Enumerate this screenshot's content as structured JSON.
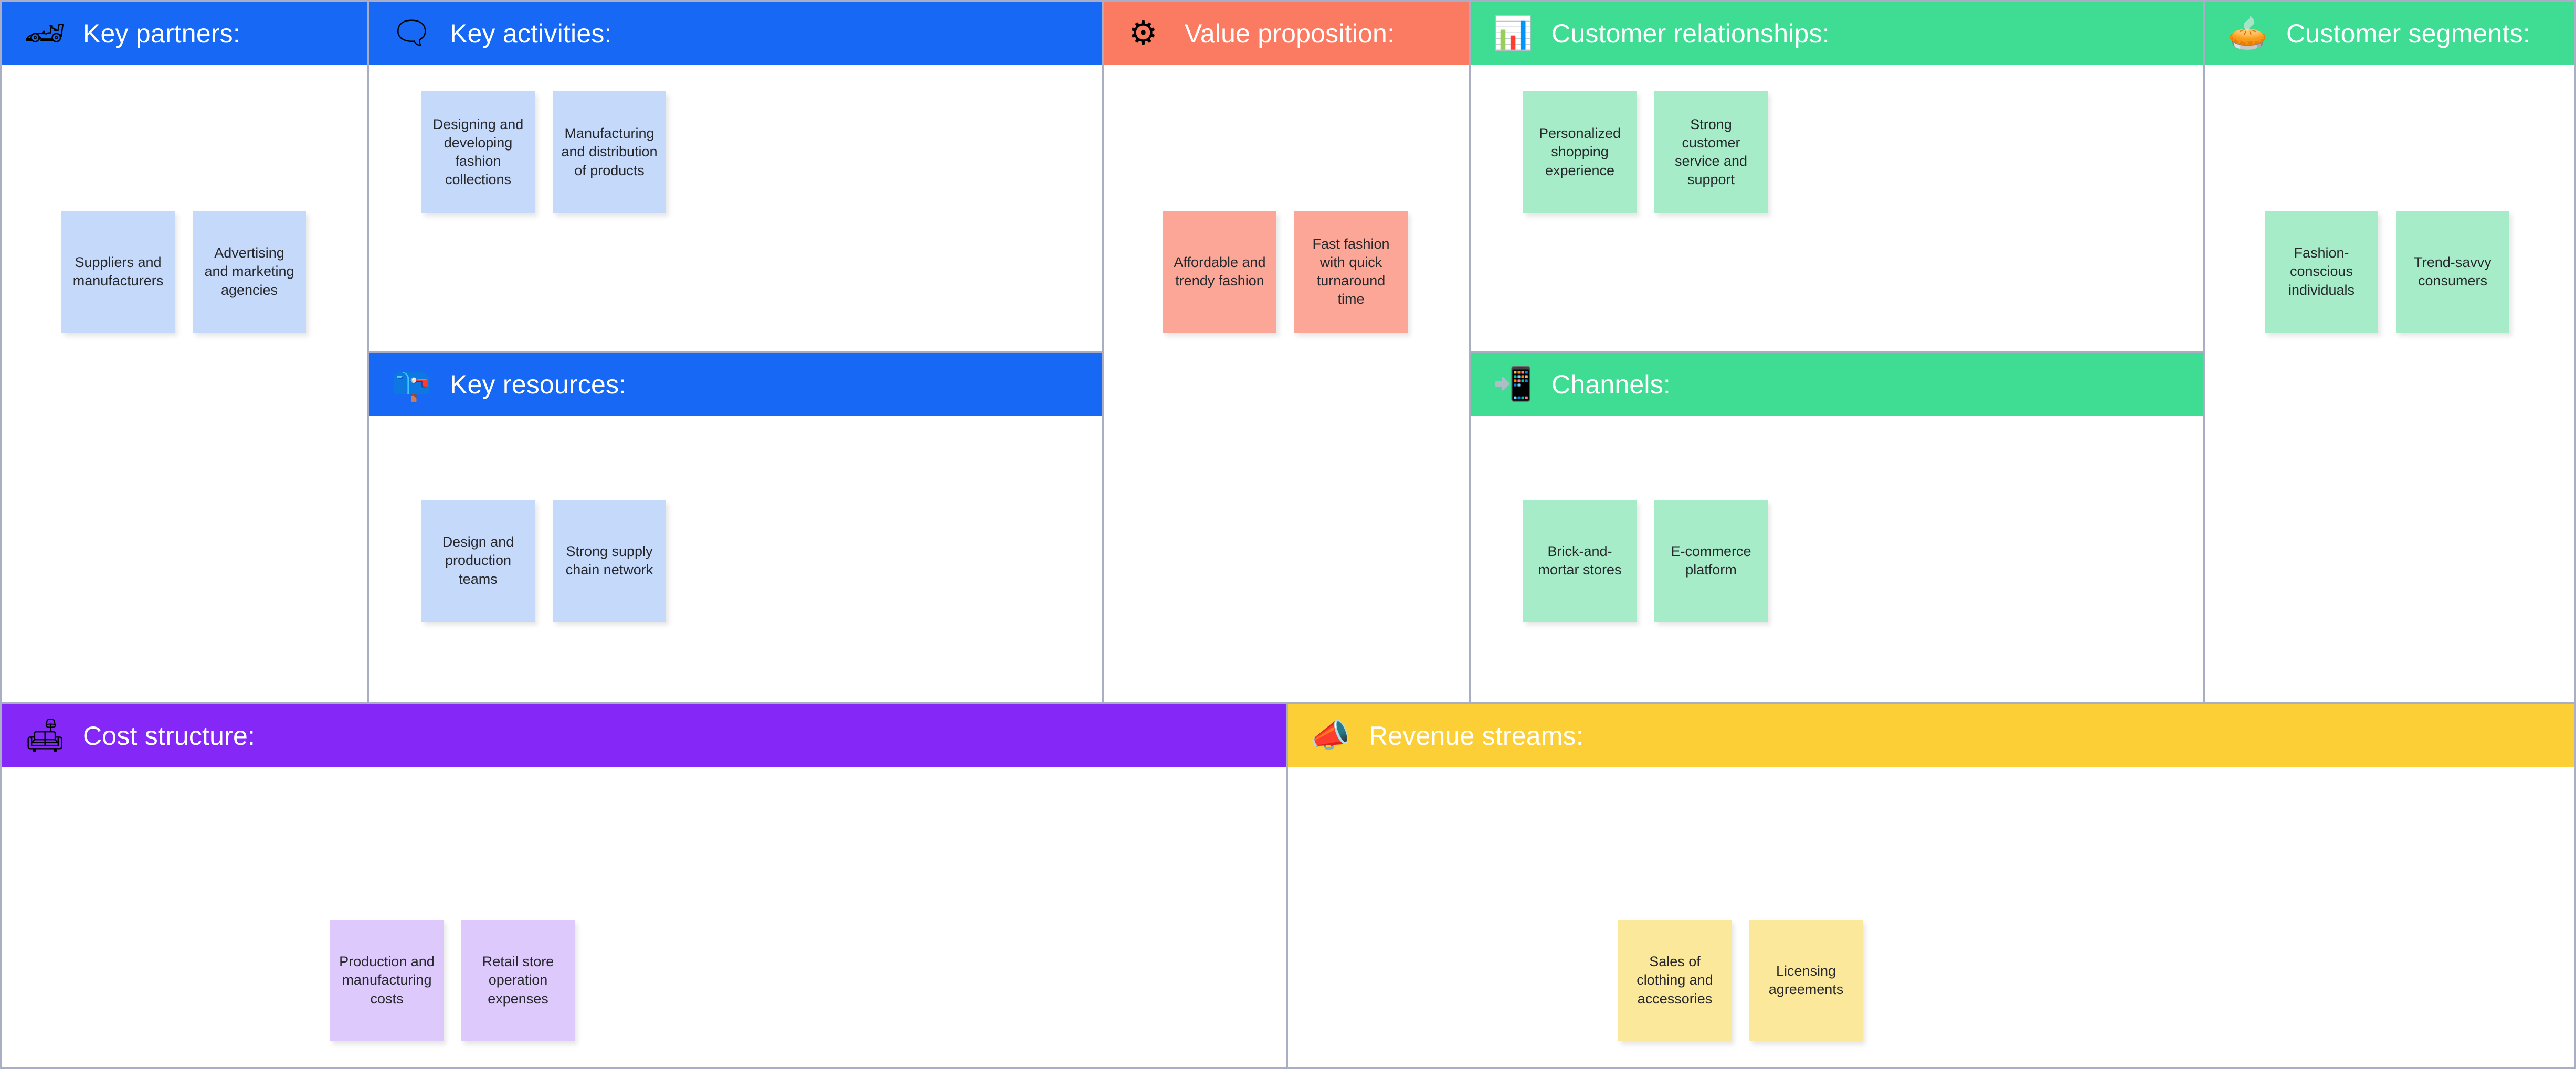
{
  "theme": {
    "background": "#a9aec4",
    "panel": "#ffffff",
    "blue": "#1668f5",
    "salmon": "#fb7b62",
    "green": "#3fdc93",
    "purple": "#8427f7",
    "yellow": "#fbcf35",
    "note_blue": "#c5d9fb",
    "note_salmon": "#fba696",
    "note_green": "#a6ecc8",
    "note_purple": "#ddc9fb",
    "note_yellow": "#fbe89a"
  },
  "blocks": {
    "key_partners": {
      "title": "Key partners:",
      "icon": "racing-car-icon",
      "icon_glyph": "🏎",
      "notes": [
        {
          "text": "Suppliers and manufacturers"
        },
        {
          "text": "Advertising and marketing agencies"
        }
      ]
    },
    "key_activities": {
      "title": "Key activities:",
      "icon": "speech-balloon-icon",
      "icon_glyph": "🗨",
      "notes": [
        {
          "text": "Designing and developing fashion collections"
        },
        {
          "text": "Manufacturing and distribution of products"
        }
      ]
    },
    "key_resources": {
      "title": "Key resources:",
      "icon": "mailbox-icon",
      "icon_glyph": "📪",
      "notes": [
        {
          "text": "Design and production teams"
        },
        {
          "text": "Strong supply chain network"
        }
      ]
    },
    "value_proposition": {
      "title": "Value proposition:",
      "icon": "gears-icon",
      "icon_glyph": "⚙",
      "notes": [
        {
          "text": "Affordable and trendy fashion"
        },
        {
          "text": "Fast fashion with quick turnaround time"
        }
      ]
    },
    "customer_relationships": {
      "title": "Customer relationships:",
      "icon": "bar-chart-icon",
      "icon_glyph": "📊",
      "notes": [
        {
          "text": "Personalized shopping experience"
        },
        {
          "text": "Strong customer service and support"
        }
      ]
    },
    "channels": {
      "title": "Channels:",
      "icon": "mobile-phone-icon",
      "icon_glyph": "📲",
      "notes": [
        {
          "text": "Brick-and-mortar stores"
        },
        {
          "text": "E-commerce platform"
        }
      ]
    },
    "customer_segments": {
      "title": "Customer segments:",
      "icon": "pie-chart-icon",
      "icon_glyph": "🥧",
      "notes": [
        {
          "text": "Fashion-conscious individuals"
        },
        {
          "text": "Trend-savvy consumers"
        }
      ]
    },
    "cost_structure": {
      "title": "Cost structure:",
      "icon": "desk-lamp-icon",
      "icon_glyph": "🛋",
      "notes": [
        {
          "text": "Production and manufacturing costs"
        },
        {
          "text": "Retail store operation expenses"
        }
      ]
    },
    "revenue_streams": {
      "title": "Revenue streams:",
      "icon": "megaphone-icon",
      "icon_glyph": "📣",
      "notes": [
        {
          "text": "Sales of clothing and accessories"
        },
        {
          "text": "Licensing agreements"
        }
      ]
    }
  }
}
